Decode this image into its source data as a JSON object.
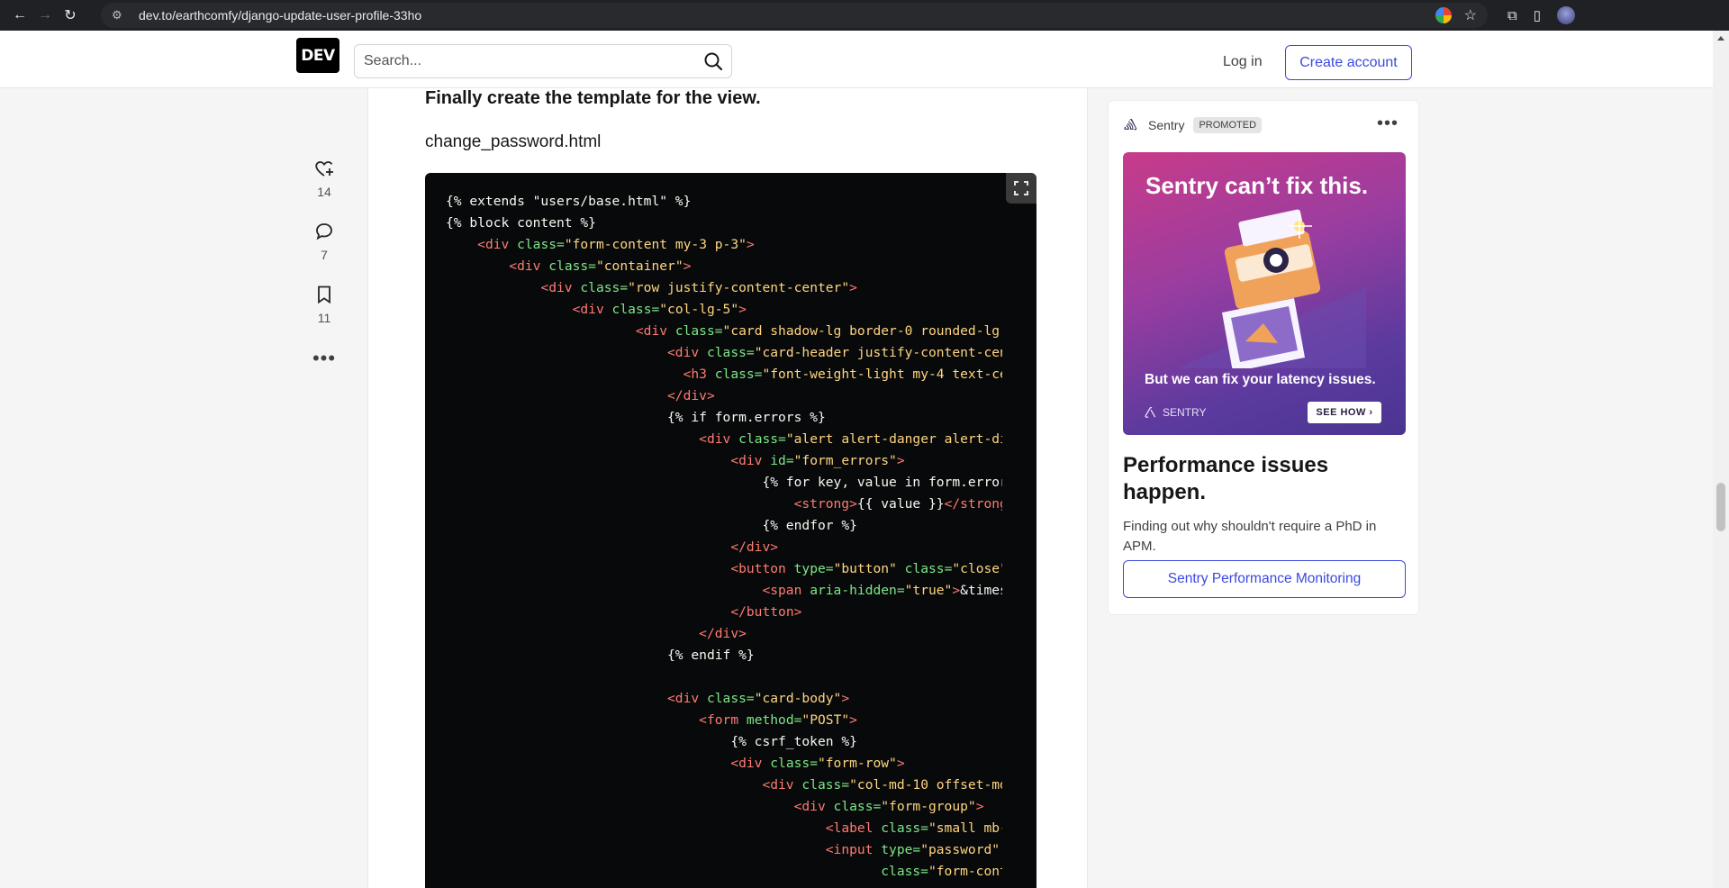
{
  "browser": {
    "url": "dev.to/earthcomfy/django-update-user-profile-33ho",
    "icons": [
      "back-icon",
      "forward-icon",
      "reload-icon",
      "site-info-icon",
      "google-icon",
      "bookmark-star-icon",
      "extensions-icon",
      "side-panel-icon",
      "profile-avatar"
    ]
  },
  "header": {
    "logo": "DEV",
    "search_placeholder": "Search...",
    "login_label": "Log in",
    "create_account_label": "Create account"
  },
  "reactions": {
    "likes": "14",
    "comments": "7",
    "bookmarks": "11"
  },
  "article": {
    "heading": "Finally create the template for the view.",
    "filename": "change_password.html"
  },
  "ad": {
    "sponsor": "Sentry",
    "badge": "PROMOTED",
    "banner_headline": "Sentry can’t fix this.",
    "banner_subline": "But we can fix your latency issues.",
    "banner_brand": "SENTRY",
    "banner_cta": "SEE HOW",
    "title": "Performance issues happen.",
    "description": "Finding out why shouldn't require a PhD in APM.",
    "cta": "Sentry Performance Monitoring"
  },
  "colors": {
    "brand": "#3b49df",
    "code_bg": "#08090a",
    "tag": "#ff7b72",
    "attr": "#7ee787",
    "string": "#ffd580"
  }
}
